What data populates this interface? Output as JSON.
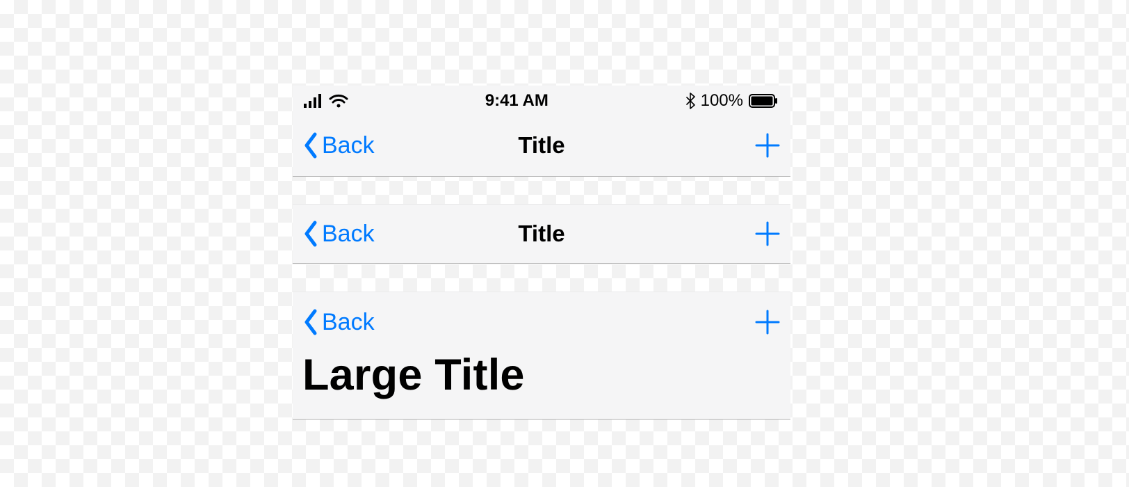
{
  "statusbar": {
    "time": "9:41 AM",
    "battery_percent": "100%"
  },
  "bars": [
    {
      "back_label": "Back",
      "title": "Title",
      "large_title": null
    },
    {
      "back_label": "Back",
      "title": "Title",
      "large_title": null
    },
    {
      "back_label": "Back",
      "title": null,
      "large_title": "Large Title"
    }
  ],
  "colors": {
    "accent": "#007aff"
  }
}
